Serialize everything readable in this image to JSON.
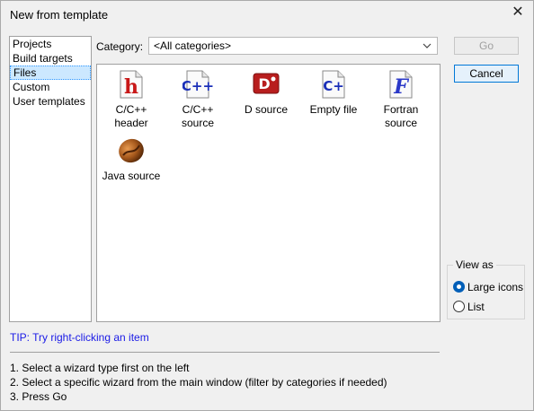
{
  "window": {
    "title": "New from template",
    "close_glyph": "✕"
  },
  "sidebar": {
    "items": [
      {
        "label": "Projects",
        "selected": false
      },
      {
        "label": "Build targets",
        "selected": false
      },
      {
        "label": "Files",
        "selected": true
      },
      {
        "label": "Custom",
        "selected": false
      },
      {
        "label": "User templates",
        "selected": false
      }
    ]
  },
  "category": {
    "label": "Category:",
    "value": "<All categories>"
  },
  "buttons": {
    "go": "Go",
    "cancel": "Cancel"
  },
  "templates": [
    {
      "name": "C/C++ header",
      "line1": "C/C++",
      "line2": "header",
      "icon": "c-header-icon"
    },
    {
      "name": "C/C++ source",
      "line1": "C/C++",
      "line2": "source",
      "icon": "cpp-source-icon"
    },
    {
      "name": "D source",
      "line1": "D source",
      "line2": "",
      "icon": "d-source-icon"
    },
    {
      "name": "Empty file",
      "line1": "Empty file",
      "line2": "",
      "icon": "empty-file-icon"
    },
    {
      "name": "Fortran source",
      "line1": "Fortran",
      "line2": "source",
      "icon": "fortran-source-icon"
    },
    {
      "name": "Java source",
      "line1": "Java source",
      "line2": "",
      "icon": "java-source-icon"
    }
  ],
  "view_as": {
    "legend": "View as",
    "options": [
      {
        "label": "Large icons",
        "selected": true
      },
      {
        "label": "List",
        "selected": false
      }
    ]
  },
  "tip": "TIP: Try right-clicking an item",
  "instructions": [
    "1. Select a wizard type first on the left",
    "2. Select a specific wizard from the main window (filter by categories if needed)",
    "3. Press Go"
  ],
  "colors": {
    "accent": "#005fb8",
    "tip_text": "#1a1ae6",
    "selection": "#cce8ff"
  }
}
